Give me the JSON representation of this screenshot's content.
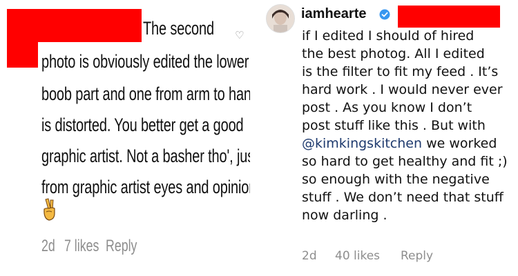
{
  "left_comment": {
    "text_lines": [
      "The second",
      "photo is obviously edited the lower",
      "boob part and one from arm to hand",
      "is distorted. You better get a good",
      "graphic artist. Not a basher tho', just",
      "from graphic artist eyes and opinion"
    ],
    "emoji": "✌️",
    "time": "2d",
    "likes": "7 likes",
    "reply": "Reply",
    "heart_icon": "heart-outline-icon"
  },
  "right_comment": {
    "username": "iamhearte",
    "verified_icon": "verified-badge-icon",
    "lines": [
      "if I edited I should of hired",
      "the best photog. All I edited",
      "is the filter to fit my feed . It’s",
      "hard work . I would never ever",
      "post . As you know I don’t",
      "post  stuff like this . But with"
    ],
    "mention": "@kimkingskitchen",
    "mention_suffix": " we worked",
    "lines_after": [
      "so hard to get healthy and fit ;)",
      "so enough with the negative",
      "stuff . We don’t need that stuff",
      "now darling ."
    ],
    "time": "2d",
    "likes": "40 likes",
    "reply": "Reply"
  },
  "colors": {
    "redaction": "#ff0000",
    "muted_text": "#8e8e8e",
    "mention": "#1e3a6e",
    "verified": "#3897f0"
  }
}
